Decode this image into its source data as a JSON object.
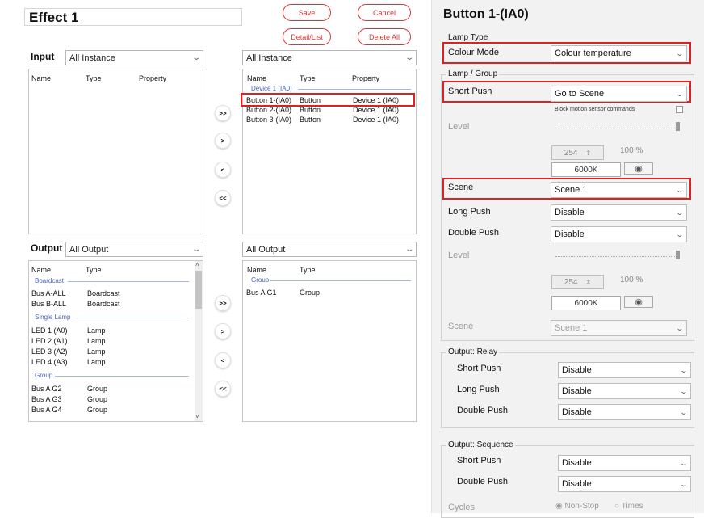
{
  "left": {
    "title": "Effect 1",
    "buttons": {
      "save": "Save",
      "cancel": "Cancel",
      "detail_list": "Detail/List",
      "delete_all": "Delete All"
    },
    "input": {
      "label": "Input",
      "src_select": "All Instance",
      "dst_select": "All Instance",
      "src_headers": [
        "Name",
        "Type",
        "Property"
      ],
      "dst_headers": [
        "Name",
        "Type",
        "Property"
      ],
      "dst_group": "Device 1 (IA0)",
      "dst_rows": [
        [
          "Button 1-(IA0)",
          "Button",
          "Device 1 (IA0)"
        ],
        [
          "Button 2-(IA0)",
          "Button",
          "Device 1 (IA0)"
        ],
        [
          "Button 3-(IA0)",
          "Button",
          "Device 1 (IA0)"
        ]
      ]
    },
    "transfer": [
      ">>",
      ">",
      "<",
      "<<"
    ],
    "output": {
      "label": "Output",
      "src_select": "All Output",
      "dst_select": "All Output",
      "src_headers": [
        "Name",
        "Type"
      ],
      "dst_headers": [
        "Name",
        "Type"
      ],
      "groups": [
        "Boardcast",
        "Single Lamp",
        "Group"
      ],
      "broadcast_rows": [
        [
          "Bus A-ALL",
          "Boardcast"
        ],
        [
          "Bus B-ALL",
          "Boardcast"
        ]
      ],
      "lamp_rows": [
        [
          "LED 1 (A0)",
          "Lamp"
        ],
        [
          "LED 2 (A1)",
          "Lamp"
        ],
        [
          "LED 3 (A2)",
          "Lamp"
        ],
        [
          "LED 4 (A3)",
          "Lamp"
        ]
      ],
      "group_rows": [
        [
          "Bus A G2",
          "Group"
        ],
        [
          "Bus A G3",
          "Group"
        ],
        [
          "Bus A G4",
          "Group"
        ]
      ],
      "dst_group": "Group",
      "dst_rows": [
        [
          "Bus A G1",
          "Group"
        ]
      ]
    }
  },
  "right": {
    "title": "Button 1-(IA0)",
    "lamp_type_legend": "Lamp Type",
    "colour_mode_label": "Colour Mode",
    "colour_mode_value": "Colour temperature",
    "lamp_group_legend": "Lamp / Group",
    "short_push_label": "Short Push",
    "short_push_value": "Go to Scene",
    "block_motion": "Block motion sensor commands",
    "level_label": "Level",
    "level_value": "254",
    "percent": "100 %",
    "kelvin": "6000K",
    "scene_label": "Scene",
    "scene_value": "Scene 1",
    "long_push_label": "Long Push",
    "long_push_value": "Disable",
    "double_push_label": "Double Push",
    "double_push_value": "Disable",
    "level2_label": "Level",
    "level2_value": "254",
    "percent2": "100 %",
    "kelvin2": "6000K",
    "scene2_label": "Scene",
    "scene2_value": "Scene 1",
    "relay_legend": "Output: Relay",
    "relay_short_label": "Short Push",
    "relay_short_value": "Disable",
    "relay_long_label": "Long Push",
    "relay_long_value": "Disable",
    "relay_double_label": "Double Push",
    "relay_double_value": "Disable",
    "seq_legend": "Output: Sequence",
    "seq_short_label": "Short Push",
    "seq_short_value": "Disable",
    "seq_double_label": "Double Push",
    "seq_double_value": "Disable",
    "cycles_label": "Cycles",
    "cycles_opt1": "Non-Stop",
    "cycles_opt2": "Times"
  },
  "colors": {
    "accent_red": "#e02020",
    "group_blue": "#4a63b8"
  }
}
